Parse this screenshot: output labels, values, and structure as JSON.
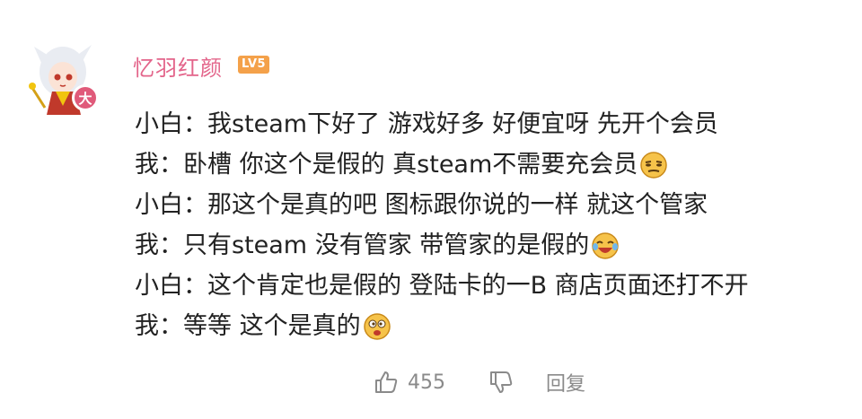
{
  "user": {
    "name": "忆羽红颜",
    "level": "LV5",
    "avatar_badge": "大"
  },
  "comment": {
    "lines": [
      {
        "text": "小白：我steam下好了 游戏好多 好便宜呀 先开个会员",
        "emoji": ""
      },
      {
        "text": "我：卧槽 你这个是假的 真steam不需要充会员",
        "emoji": "smug-face-emoji"
      },
      {
        "text": "小白：那这个是真的吧 图标跟你说的一样 就这个管家",
        "emoji": ""
      },
      {
        "text": "我：只有steam 没有管家 带管家的是假的",
        "emoji": "laughing-crying-emoji"
      },
      {
        "text": "小白：这个肯定也是假的 登陆卡的一B 商店页面还打不开",
        "emoji": ""
      },
      {
        "text": "我：等等 这个是真的",
        "emoji": "dizzy-face-emoji"
      }
    ]
  },
  "actions": {
    "like_icon": "thumbs-up-icon",
    "like_count": "455",
    "dislike_icon": "thumbs-down-icon",
    "reply_label": "回复"
  },
  "colors": {
    "username": "#e3648a",
    "level_badge": "#f4a14a",
    "text": "#222222",
    "muted": "#8a8a8a"
  }
}
